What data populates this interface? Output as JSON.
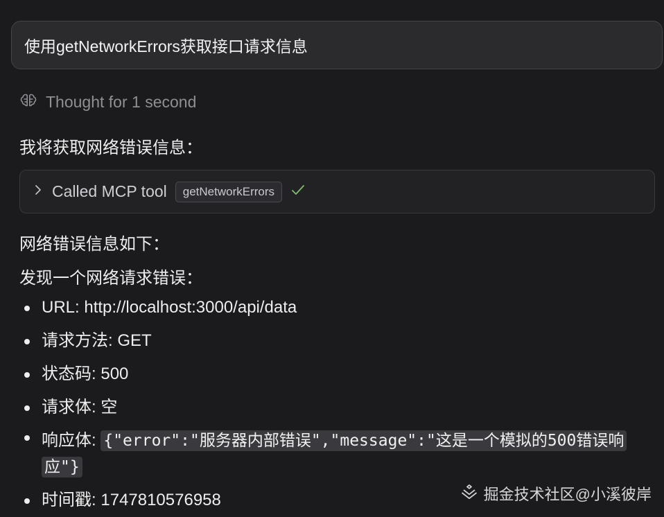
{
  "user_message": "使用getNetworkErrors获取接口请求信息",
  "thought": {
    "icon": "brain-icon",
    "label": "Thought for 1 second"
  },
  "intro": "我将获取网络错误信息：",
  "tool_call": {
    "label": "Called MCP tool",
    "tool_name": "getNetworkErrors",
    "status_icon": "check-icon",
    "status_color": "#7fbf6a"
  },
  "result_heading": "网络错误信息如下：",
  "found_line": "发现一个网络请求错误：",
  "details": {
    "url_label": "URL: ",
    "url_value": "http://localhost:3000/api/data",
    "method_label": "请求方法: ",
    "method_value": "GET",
    "status_label": "状态码: ",
    "status_value": "500",
    "request_body_label": "请求体: ",
    "request_body_value": "空",
    "response_body_label": "响应体: ",
    "response_body_value": "{\"error\":\"服务器内部错误\",\"message\":\"这是一个模拟的500错误响应\"}",
    "timestamp_label": "时间戳: ",
    "timestamp_value": "1747810576958"
  },
  "watermark": "掘金技术社区@小溪彼岸"
}
